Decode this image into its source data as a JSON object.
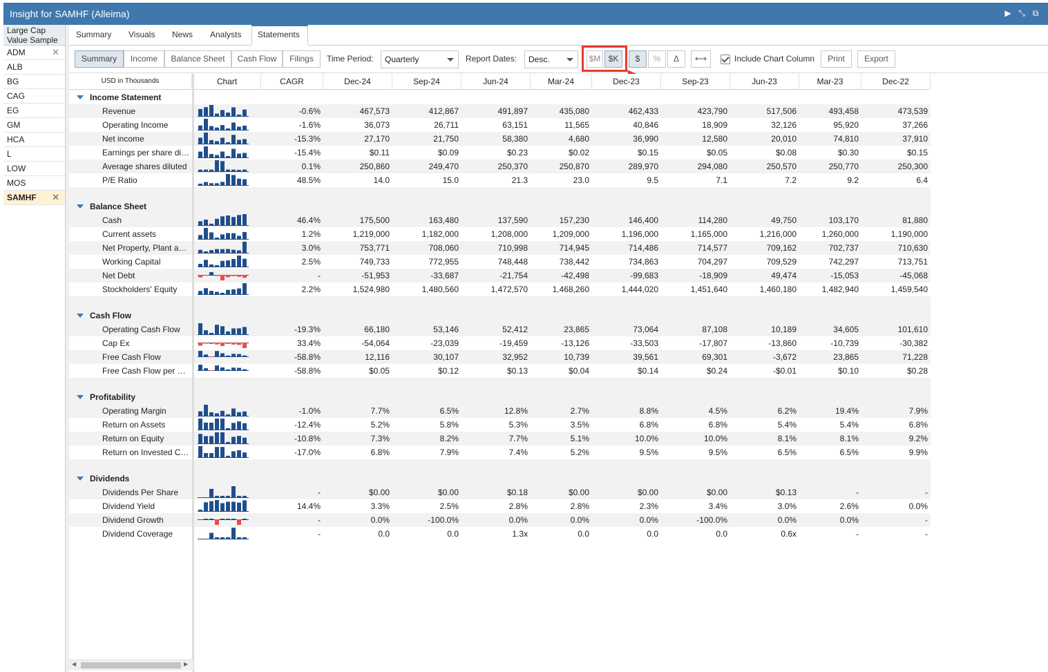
{
  "window": {
    "title": "Insight for SAMHF (Alleima)"
  },
  "sample_list": {
    "title": "Large Cap Value Sample",
    "items": [
      {
        "ticker": "ADM",
        "removable": true,
        "selected": false
      },
      {
        "ticker": "ALB",
        "removable": false,
        "selected": false
      },
      {
        "ticker": "BG",
        "removable": false,
        "selected": false
      },
      {
        "ticker": "CAG",
        "removable": false,
        "selected": false
      },
      {
        "ticker": "EG",
        "removable": false,
        "selected": false
      },
      {
        "ticker": "GM",
        "removable": false,
        "selected": false
      },
      {
        "ticker": "HCA",
        "removable": false,
        "selected": false
      },
      {
        "ticker": "L",
        "removable": false,
        "selected": false
      },
      {
        "ticker": "LOW",
        "removable": false,
        "selected": false
      },
      {
        "ticker": "MOS",
        "removable": false,
        "selected": false
      },
      {
        "ticker": "SAMHF",
        "removable": true,
        "selected": true
      }
    ]
  },
  "tabs": [
    "Summary",
    "Visuals",
    "News",
    "Analysts",
    "Statements"
  ],
  "active_tab": "Statements",
  "toolbar": {
    "subtabs": [
      "Summary",
      "Income",
      "Balance Sheet",
      "Cash Flow",
      "Filings"
    ],
    "time_period_label": "Time Period:",
    "time_period_value": "Quarterly",
    "report_dates_label": "Report Dates:",
    "report_dates_value": "Desc.",
    "unit_millions": "$M",
    "unit_thousands": "$K",
    "dollar": "$",
    "percent": "%",
    "delta": "Δ",
    "include_chart": "Include Chart Column",
    "print": "Print",
    "export": "Export"
  },
  "grid": {
    "units_label": "USD in Thousands",
    "chart_header": "Chart",
    "cagr_header": "CAGR",
    "periods": [
      "Dec-24",
      "Sep-24",
      "Jun-24",
      "Mar-24",
      "Dec-23",
      "Sep-23",
      "Jun-23",
      "Mar-23",
      "Dec-22"
    ],
    "sections": [
      {
        "title": "Income Statement",
        "rows": [
          {
            "name": "Revenue",
            "cagr": "-0.6%",
            "values": [
              "467,573",
              "412,867",
              "491,897",
              "435,080",
              "462,433",
              "423,790",
              "517,506",
              "493,458",
              "473,539"
            ]
          },
          {
            "name": "Operating Income",
            "cagr": "-1.6%",
            "values": [
              "36,073",
              "26,711",
              "63,151",
              "11,565",
              "40,846",
              "18,909",
              "32,126",
              "95,920",
              "37,266"
            ]
          },
          {
            "name": "Net income",
            "cagr": "-15.3%",
            "values": [
              "27,170",
              "21,750",
              "58,380",
              "4,680",
              "36,990",
              "12,580",
              "20,010",
              "74,810",
              "37,910"
            ]
          },
          {
            "name": "Earnings per share diluted",
            "cagr": "-15.4%",
            "values": [
              "$0.11",
              "$0.09",
              "$0.23",
              "$0.02",
              "$0.15",
              "$0.05",
              "$0.08",
              "$0.30",
              "$0.15"
            ]
          },
          {
            "name": "Average shares diluted",
            "cagr": "0.1%",
            "values": [
              "250,860",
              "249,470",
              "250,370",
              "250,870",
              "289,970",
              "294,080",
              "250,570",
              "250,770",
              "250,300"
            ]
          },
          {
            "name": "P/E Ratio",
            "cagr": "48.5%",
            "values": [
              "14.0",
              "15.0",
              "21.3",
              "23.0",
              "9.5",
              "7.1",
              "7.2",
              "9.2",
              "6.4"
            ]
          }
        ]
      },
      {
        "title": "Balance Sheet",
        "rows": [
          {
            "name": "Cash",
            "cagr": "46.4%",
            "values": [
              "175,500",
              "163,480",
              "137,590",
              "157,230",
              "146,400",
              "114,280",
              "49,750",
              "103,170",
              "81,880"
            ]
          },
          {
            "name": "Current assets",
            "cagr": "1.2%",
            "values": [
              "1,219,000",
              "1,182,000",
              "1,208,000",
              "1,209,000",
              "1,196,000",
              "1,165,000",
              "1,216,000",
              "1,260,000",
              "1,190,000"
            ]
          },
          {
            "name": "Net Property, Plant and Equipment",
            "cagr": "3.0%",
            "values": [
              "753,771",
              "708,060",
              "710,998",
              "714,945",
              "714,486",
              "714,577",
              "709,162",
              "702,737",
              "710,630"
            ]
          },
          {
            "name": "Working Capital",
            "cagr": "2.5%",
            "values": [
              "749,733",
              "772,955",
              "748,448",
              "738,442",
              "734,863",
              "704,297",
              "709,529",
              "742,297",
              "713,751"
            ]
          },
          {
            "name": "Net Debt",
            "cagr": "-",
            "values": [
              "-51,953",
              "-33,687",
              "-21,754",
              "-42,498",
              "-99,683",
              "-18,909",
              "49,474",
              "-15,053",
              "-45,068"
            ]
          },
          {
            "name": "Stockholders' Equity",
            "cagr": "2.2%",
            "values": [
              "1,524,980",
              "1,480,560",
              "1,472,570",
              "1,468,260",
              "1,444,020",
              "1,451,640",
              "1,460,180",
              "1,482,940",
              "1,459,540"
            ]
          }
        ]
      },
      {
        "title": "Cash Flow",
        "rows": [
          {
            "name": "Operating Cash Flow",
            "cagr": "-19.3%",
            "values": [
              "66,180",
              "53,146",
              "52,412",
              "23,865",
              "73,064",
              "87,108",
              "10,189",
              "34,605",
              "101,610"
            ]
          },
          {
            "name": "Cap Ex",
            "cagr": "33.4%",
            "values": [
              "-54,064",
              "-23,039",
              "-19,459",
              "-13,126",
              "-33,503",
              "-17,807",
              "-13,860",
              "-10,739",
              "-30,382"
            ]
          },
          {
            "name": "Free Cash Flow",
            "cagr": "-58.8%",
            "values": [
              "12,116",
              "30,107",
              "32,952",
              "10,739",
              "39,561",
              "69,301",
              "-3,672",
              "23,865",
              "71,228"
            ]
          },
          {
            "name": "Free Cash Flow per Share",
            "cagr": "-58.8%",
            "values": [
              "$0.05",
              "$0.12",
              "$0.13",
              "$0.04",
              "$0.14",
              "$0.24",
              "-$0.01",
              "$0.10",
              "$0.28"
            ]
          }
        ]
      },
      {
        "title": "Profitability",
        "rows": [
          {
            "name": "Operating Margin",
            "cagr": "-1.0%",
            "values": [
              "7.7%",
              "6.5%",
              "12.8%",
              "2.7%",
              "8.8%",
              "4.5%",
              "6.2%",
              "19.4%",
              "7.9%"
            ]
          },
          {
            "name": "Return on Assets",
            "cagr": "-12.4%",
            "values": [
              "5.2%",
              "5.8%",
              "5.3%",
              "3.5%",
              "6.8%",
              "6.8%",
              "5.4%",
              "5.4%",
              "6.8%"
            ]
          },
          {
            "name": "Return on Equity",
            "cagr": "-10.8%",
            "values": [
              "7.3%",
              "8.2%",
              "7.7%",
              "5.1%",
              "10.0%",
              "10.0%",
              "8.1%",
              "8.1%",
              "9.2%"
            ]
          },
          {
            "name": "Return on Invested Capital",
            "cagr": "-17.0%",
            "values": [
              "6.8%",
              "7.9%",
              "7.4%",
              "5.2%",
              "9.5%",
              "9.5%",
              "6.5%",
              "6.5%",
              "9.9%"
            ]
          }
        ]
      },
      {
        "title": "Dividends",
        "rows": [
          {
            "name": "Dividends Per Share",
            "cagr": "-",
            "values": [
              "$0.00",
              "$0.00",
              "$0.18",
              "$0.00",
              "$0.00",
              "$0.00",
              "$0.13",
              "-",
              "-"
            ]
          },
          {
            "name": "Dividend Yield",
            "cagr": "14.4%",
            "values": [
              "3.3%",
              "2.5%",
              "2.8%",
              "2.8%",
              "2.3%",
              "3.4%",
              "3.0%",
              "2.6%",
              "0.0%"
            ]
          },
          {
            "name": "Dividend Growth",
            "cagr": "-",
            "values": [
              "0.0%",
              "-100.0%",
              "0.0%",
              "0.0%",
              "0.0%",
              "-100.0%",
              "0.0%",
              "0.0%",
              "-"
            ]
          },
          {
            "name": "Dividend Coverage",
            "cagr": "-",
            "values": [
              "0.0",
              "0.0",
              "1.3x",
              "0.0",
              "0.0",
              "0.0",
              "0.6x",
              "-",
              "-"
            ]
          }
        ]
      }
    ]
  },
  "colors": {
    "title_bar": "#3e78ac",
    "spark_pos": "#1f4e8c",
    "spark_neg": "#f04a4a",
    "highlight": "#e8392a"
  }
}
